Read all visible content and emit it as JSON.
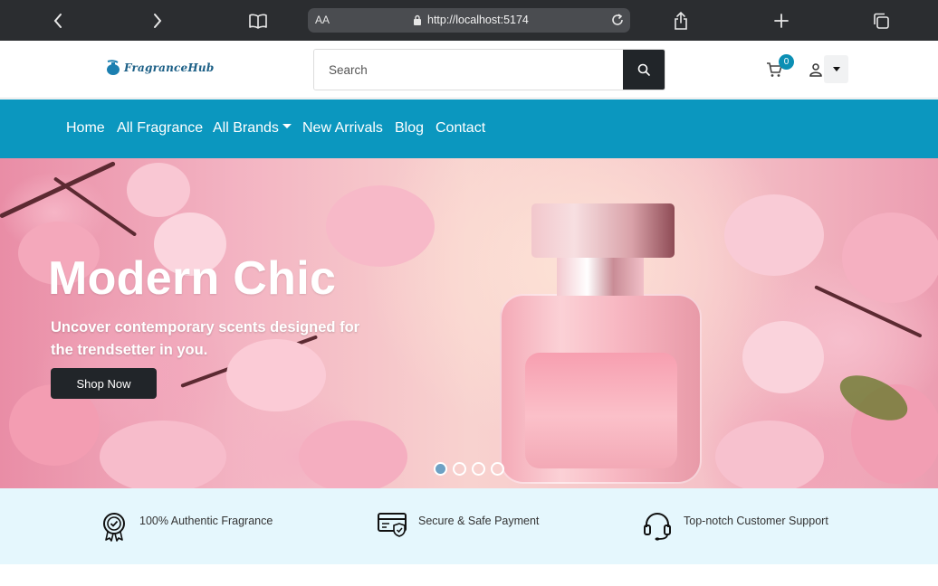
{
  "browser": {
    "text_size_label": "AA",
    "url": "http://localhost:5174"
  },
  "header": {
    "logo_text": "FragranceHub",
    "search_placeholder": "Search",
    "cart_count": "0"
  },
  "nav": {
    "items": [
      {
        "label": "Home"
      },
      {
        "label": "All Fragrance"
      },
      {
        "label": "All Brands"
      },
      {
        "label": "New Arrivals"
      },
      {
        "label": "Blog"
      },
      {
        "label": "Contact"
      }
    ]
  },
  "hero": {
    "title": "Modern Chic",
    "subtitle": "Uncover contemporary scents designed for the trendsetter in you.",
    "button_label": "Shop Now",
    "slide_count": 4,
    "active_slide": 1
  },
  "features": [
    {
      "icon": "award-badge-icon",
      "label": "100% Authentic Fragrance"
    },
    {
      "icon": "secure-card-icon",
      "label": "Secure & Safe Payment"
    },
    {
      "icon": "headset-icon",
      "label": "Top-notch Customer Support"
    }
  ],
  "colors": {
    "nav_bg": "#0b97bf",
    "dark_button": "#212529",
    "feature_strip_bg": "#e5f7fd",
    "badge": "#0b8fb4"
  }
}
